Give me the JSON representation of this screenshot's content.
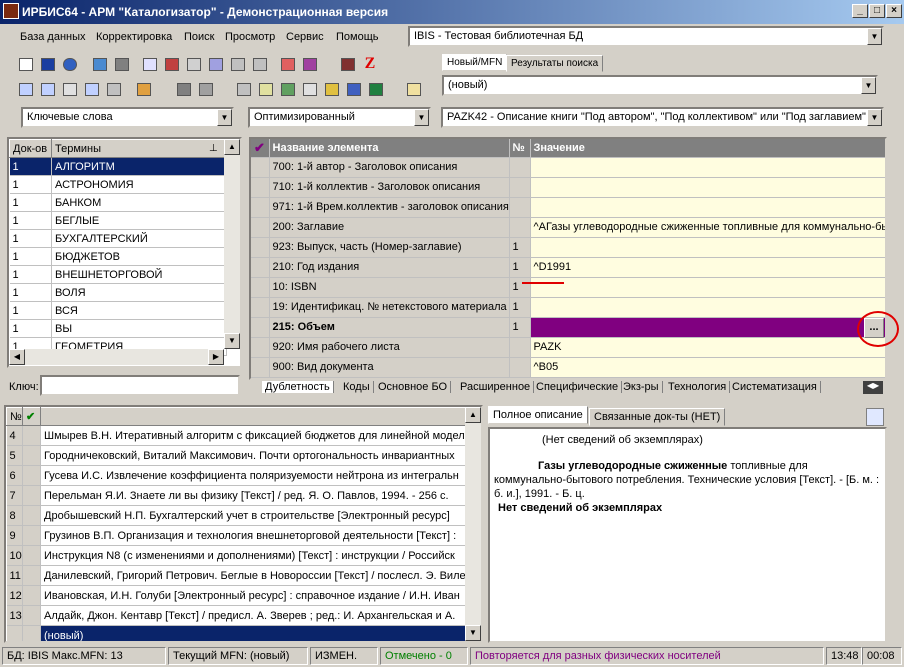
{
  "window": {
    "title": "ИРБИС64 - АРМ \"Каталогизатор\" - Демонстрационная версия"
  },
  "menu": [
    "База данных",
    "Корректировка",
    "Поиск",
    "Просмотр",
    "Сервис",
    "Помощь"
  ],
  "db_combo": "IBIS - Тестовая библиотечная БД",
  "mfn_tabs": [
    "Новый/MFN",
    "Результаты поиска"
  ],
  "mfn_combo": "(новый)",
  "search_combo": "Ключевые слова",
  "mode_combo": "Оптимизированный",
  "worksheet_combo": "PAZK42 - Описание книги \"Под автором\", \"Под коллективом\" или \"Под заглавием\"",
  "terms": {
    "headers": [
      "Док-ов",
      "Термины"
    ],
    "rows": [
      [
        "1",
        "АЛГОРИТМ"
      ],
      [
        "1",
        "АСТРОНОМИЯ"
      ],
      [
        "1",
        "БАНКОМ"
      ],
      [
        "1",
        "БЕГЛЫЕ"
      ],
      [
        "1",
        "БУХГАЛТЕРСКИЙ"
      ],
      [
        "1",
        "БЮДЖЕТОВ"
      ],
      [
        "1",
        "ВНЕШНЕТОРГОВОЙ"
      ],
      [
        "1",
        "ВОЛЯ"
      ],
      [
        "1",
        "ВСЯ"
      ],
      [
        "1",
        "ВЫ"
      ],
      [
        "1",
        "ГЕОМЕТРИЯ"
      ]
    ],
    "key_label": "Ключ:"
  },
  "fields": {
    "headers": [
      "Название элемента",
      "№",
      "Значение"
    ],
    "rows": [
      [
        "700: 1-й автор - Заголовок описания",
        "",
        ""
      ],
      [
        "710: 1-й коллектив - Заголовок описания",
        "",
        ""
      ],
      [
        "971: 1-й Врем.коллектив - заголовок описания",
        "",
        ""
      ],
      [
        "200: Заглавие",
        "",
        "^AГазы углеводородные сжиженные топливные для коммунально-бытового потребления"
      ],
      [
        "923: Выпуск, часть (Номер-заглавие)",
        "1",
        ""
      ],
      [
        "210: Год издания",
        "1",
        "^D1991"
      ],
      [
        "10: ISBN",
        "1",
        ""
      ],
      [
        "19: Идентификац. № нетекстового материала",
        "1",
        ""
      ],
      [
        "215: Объем",
        "1",
        ""
      ],
      [
        "920: Имя рабочего листа",
        "",
        "PAZK"
      ],
      [
        "900: Вид документа",
        "",
        "^B05"
      ]
    ],
    "ellipsis": "...",
    "tabs": [
      "Дублетность",
      "Коды",
      "Основное БО",
      "Расширенное",
      "Специфические",
      "Экз-ры",
      "Технология",
      "Систематизация"
    ]
  },
  "results": {
    "header": "№",
    "rows": [
      [
        "4",
        "Шмырев В.Н. Итеративный алгоритм с фиксацией бюджетов для линейной модели"
      ],
      [
        "5",
        "Городничековский, Виталий Максимович. Почти ортогональность инвариантных"
      ],
      [
        "6",
        "Гусева И.С. Извлечение коэффициента поляризуемости нейтрона из интегральн"
      ],
      [
        "7",
        "Перельман Я.И. Знаете ли вы физику [Текст] / ред. Я. О. Павлов, 1994. - 256 с."
      ],
      [
        "8",
        "Дробышевский Н.П. Бухгалтерский учет в строительстве [Электронный ресурс]"
      ],
      [
        "9",
        "Грузинов В.П. Организация и технология внешнеторговой деятельности [Текст] :"
      ],
      [
        "10",
        "Инструкция N8   (с изменениями и дополнениями) [Текст] : инструкции / Российск"
      ],
      [
        "11",
        "Данилевский, Григорий Петрович. Беглые в Новороссии [Текст] / послесл. Э. Виле"
      ],
      [
        "12",
        "Ивановская, И.Н. Голуби [Электронный ресурс] : справочное издание / И.Н. Иван"
      ],
      [
        "13",
        "Алдайк, Джон. Кентавр [Текст] / предисл. А. Зверев ; ред.: И. Архангельская и А."
      ],
      [
        "",
        "(новый)"
      ]
    ]
  },
  "description": {
    "tabs": [
      "Полное описание",
      "Связанные док-ты (НЕТ)"
    ],
    "line1": "(Нет сведений об экземплярах)",
    "title_bold": "Газы углеводородные сжиженные",
    "body": " топливные для коммунально-бытового потребления. Технические условия [Текст]. - [Б. м. : б. и.], 1991. - Б. ц.",
    "line_last": "Нет сведений об экземплярах"
  },
  "status": {
    "db": "БД: IBIS Макс.MFN: 13",
    "current": "Текущий MFN: (новый)",
    "changed": "ИЗМЕН.",
    "marked": "Отмечено - 0",
    "repeat": "Повторяется для разных физических носителей",
    "time": "13:48",
    "time2": "00:08"
  },
  "colors": {
    "title": "#0a246a",
    "selected": "#0a246a",
    "field_selected": "#800080",
    "marked": "#008000",
    "repeat": "#800080",
    "highlight_ring": "#e00000"
  }
}
